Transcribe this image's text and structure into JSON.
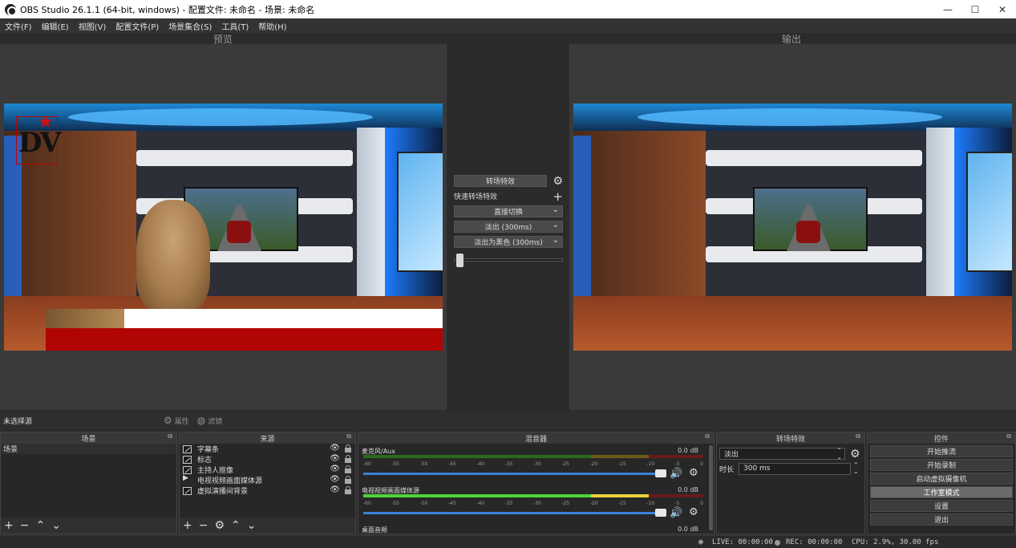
{
  "window": {
    "title": "OBS Studio 26.1.1 (64-bit, windows) - 配置文件: 未命名 - 场景: 未命名",
    "minimize": "—",
    "maximize": "☐",
    "close": "✕"
  },
  "menu": [
    "文件(F)",
    "编辑(E)",
    "视图(V)",
    "配置文件(P)",
    "场景集合(S)",
    "工具(T)",
    "帮助(H)"
  ],
  "preview_label": "预览",
  "program_label": "输出",
  "transition_center": {
    "transition_button": "转场特效",
    "quick_label": "快速转场特效",
    "items": [
      "直接切换",
      "淡出 (300ms)",
      "淡出为黑色 (300ms)"
    ]
  },
  "tbar_position": 0.02,
  "status_strip": {
    "no_selection": "未选择源",
    "properties": "属性",
    "filters": "滤镜"
  },
  "scenes": {
    "title": "场景",
    "items": [
      "场景"
    ]
  },
  "sources": {
    "title": "来源",
    "items": [
      {
        "name": "字幕条",
        "icon": "image-icon"
      },
      {
        "name": "标志",
        "icon": "image-icon"
      },
      {
        "name": "主持人抠像",
        "icon": "image-icon"
      },
      {
        "name": "电视视频画面媒体源",
        "icon": "play-icon"
      },
      {
        "name": "虚拟演播间背景",
        "icon": "image-icon"
      }
    ]
  },
  "mixer": {
    "title": "混音器",
    "channels": [
      {
        "name": "麦克风/Aux",
        "db": "0.0 dB",
        "level": 0
      },
      {
        "name": "电视视频画面媒体源",
        "db": "0.0 dB",
        "level": 0.92
      },
      {
        "name": "桌面音频",
        "db": "0.0 dB",
        "level": 0
      }
    ],
    "ticks": [
      "-60",
      "-55",
      "-50",
      "-45",
      "-40",
      "-35",
      "-30",
      "-25",
      "-20",
      "-15",
      "-10",
      "-5",
      "0"
    ]
  },
  "transitions_dock": {
    "title": "转场特效",
    "selected": "淡出",
    "duration_label": "时长",
    "duration_value": "300 ms"
  },
  "controls": {
    "title": "控件",
    "buttons": [
      "开始推流",
      "开始录制",
      "启动虚拟摄像机",
      "工作室模式",
      "设置",
      "退出"
    ],
    "active_index": 3
  },
  "statusbar": {
    "live": "LIVE: 00:00:00",
    "rec": "REC: 00:00:00",
    "cpu": "CPU: 2.9%, 30.00 fps"
  },
  "logo_text": "DV",
  "colors": {
    "accent_blue": "#3b7fd6",
    "meter_green": "#4fd33a",
    "meter_yellow": "#e8d23a",
    "lower_third_red": "#b10505"
  }
}
